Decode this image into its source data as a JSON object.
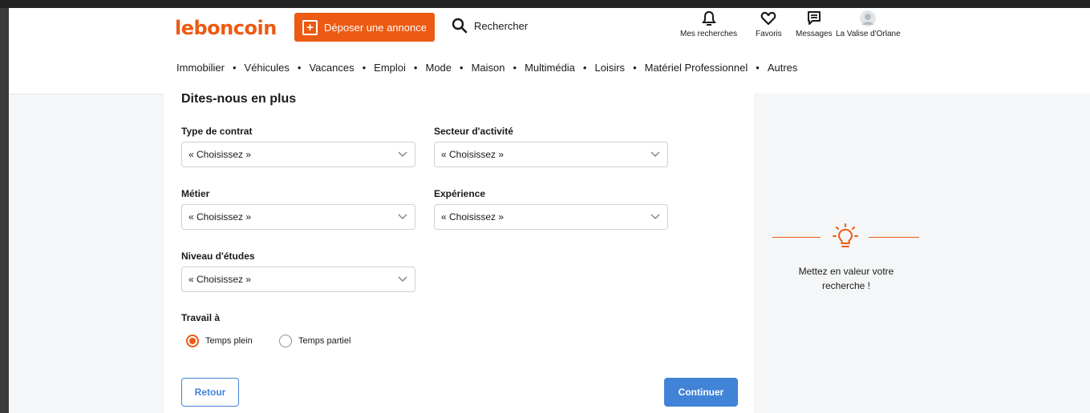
{
  "header": {
    "logo": "leboncoin",
    "deposit_label": "Déposer une annonce",
    "search_label": "Rechercher",
    "nav": [
      {
        "label": "Mes recherches",
        "icon": "bell-icon"
      },
      {
        "label": "Favoris",
        "icon": "heart-icon"
      },
      {
        "label": "Messages",
        "icon": "message-icon"
      },
      {
        "label": "La Valise d'Orlane",
        "icon": "avatar-icon"
      }
    ],
    "categories": [
      "Immobilier",
      "Véhicules",
      "Vacances",
      "Emploi",
      "Mode",
      "Maison",
      "Multimédia",
      "Loisirs",
      "Matériel Professionnel",
      "Autres"
    ],
    "separator": "•"
  },
  "form": {
    "title": "Dites-nous en plus",
    "fields": {
      "type_contrat": {
        "label": "Type de contrat",
        "value": "« Choisissez »"
      },
      "secteur": {
        "label": "Secteur d'activité",
        "value": "« Choisissez »"
      },
      "metier": {
        "label": "Métier",
        "value": "« Choisissez »"
      },
      "experience": {
        "label": "Expérience",
        "value": "« Choisissez »"
      },
      "niveau": {
        "label": "Niveau d'études",
        "value": "« Choisissez »"
      }
    },
    "travail": {
      "label": "Travail à",
      "options": [
        {
          "label": "Temps plein",
          "checked": true
        },
        {
          "label": "Temps partiel",
          "checked": false
        }
      ]
    },
    "back_label": "Retour",
    "continue_label": "Continuer"
  },
  "tip": {
    "text_line1": "Mettez en valeur votre",
    "text_line2": "recherche !"
  },
  "colors": {
    "brand": "#ec5a13",
    "primary_button": "#4183d7",
    "page_bg": "#f4f6f7"
  }
}
